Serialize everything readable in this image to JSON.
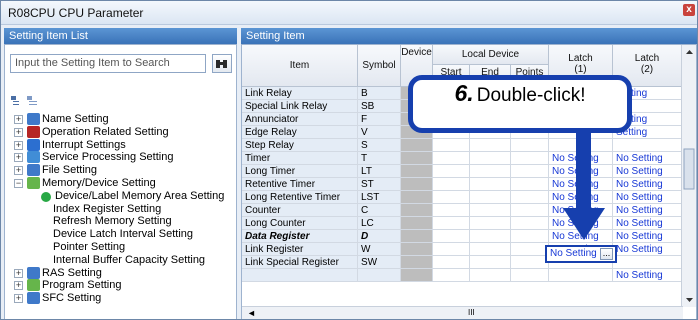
{
  "window": {
    "title": "R08CPU CPU Parameter",
    "close_glyph": "x"
  },
  "left_pane": {
    "header": "Setting Item List",
    "search_placeholder": "Input the Setting Item to Search",
    "tree": [
      {
        "label": "Name Setting",
        "expander": "+",
        "icon_color": "#3f79c9"
      },
      {
        "label": "Operation Related Setting",
        "expander": "+",
        "icon_color": "#b62525"
      },
      {
        "label": "Interrupt Settings",
        "expander": "+",
        "icon_color": "#2c6fd0"
      },
      {
        "label": "Service Processing Setting",
        "expander": "+",
        "icon_color": "#418dd6"
      },
      {
        "label": "File Setting",
        "expander": "+",
        "icon_color": "#3f79c9"
      },
      {
        "label": "Memory/Device Setting",
        "expander": "−",
        "icon_color": "#66b54b"
      },
      {
        "label": "Device/Label Memory Area Setting",
        "expander": "",
        "icon_color": "#28a845"
      },
      {
        "label": "Index Register Setting",
        "expander": "",
        "icon_color": ""
      },
      {
        "label": "Refresh Memory Setting",
        "expander": "",
        "icon_color": ""
      },
      {
        "label": "Device Latch Interval Setting",
        "expander": "",
        "icon_color": ""
      },
      {
        "label": "Pointer Setting",
        "expander": "",
        "icon_color": ""
      },
      {
        "label": "Internal Buffer Capacity Setting",
        "expander": "",
        "icon_color": ""
      },
      {
        "label": "RAS Setting",
        "expander": "+",
        "icon_color": "#3f79c9"
      },
      {
        "label": "Program Setting",
        "expander": "+",
        "icon_color": "#66b54b"
      },
      {
        "label": "SFC Setting",
        "expander": "+",
        "icon_color": "#3f79c9"
      }
    ]
  },
  "right_pane": {
    "header": "Setting Item",
    "columns": {
      "item": "Item",
      "symbol": "Symbol",
      "device": "Device",
      "local_device": "Local Device",
      "local_sub": [
        "Start",
        "End",
        "Points"
      ],
      "latch1": "Latch\n(1)",
      "latch2": "Latch\n(2)"
    },
    "rows": [
      {
        "item": "Link Relay",
        "symbol": "B",
        "latch1": "",
        "latch2": "Setting",
        "bold": false
      },
      {
        "item": "Special Link Relay",
        "symbol": "SB",
        "latch1": "",
        "latch2": "",
        "bold": false
      },
      {
        "item": "Annunciator",
        "symbol": "F",
        "latch1": "",
        "latch2": "Setting",
        "bold": false
      },
      {
        "item": "Edge Relay",
        "symbol": "V",
        "latch1": "",
        "latch2": "Setting",
        "bold": false
      },
      {
        "item": "Step Relay",
        "symbol": "S",
        "latch1": "",
        "latch2": "",
        "bold": false
      },
      {
        "item": "Timer",
        "symbol": "T",
        "latch1": "No Setting",
        "latch2": "No Setting",
        "bold": false
      },
      {
        "item": "Long Timer",
        "symbol": "LT",
        "latch1": "No Setting",
        "latch2": "No Setting",
        "bold": false
      },
      {
        "item": "Retentive Timer",
        "symbol": "ST",
        "latch1": "No Setting",
        "latch2": "No Setting",
        "bold": false
      },
      {
        "item": "Long Retentive Timer",
        "symbol": "LST",
        "latch1": "No Setting",
        "latch2": "No Setting",
        "bold": false
      },
      {
        "item": "Counter",
        "symbol": "C",
        "latch1": "No Setting",
        "latch2": "No Setting",
        "bold": false
      },
      {
        "item": "Long Counter",
        "symbol": "LC",
        "latch1": "No Setting",
        "latch2": "No Setting",
        "bold": false
      },
      {
        "item": "Data Register",
        "symbol": "D",
        "latch1": "No Setting",
        "latch2": "No Setting",
        "bold": true
      },
      {
        "item": "Link Register",
        "symbol": "W",
        "latch1": "No Setting",
        "latch2": "No Setting",
        "bold": false
      },
      {
        "item": "Link Special Register",
        "symbol": "SW",
        "latch1": "",
        "latch2": "",
        "bold": false
      },
      {
        "item": "",
        "symbol": "",
        "latch1": "",
        "latch2": "No Setting",
        "bold": false
      }
    ],
    "scroll_marker": "III"
  },
  "callout": {
    "step": "6.",
    "text": "Double-click!",
    "color": "#163fae"
  },
  "highlight_cell": {
    "value": "No Setting",
    "button": "..."
  }
}
